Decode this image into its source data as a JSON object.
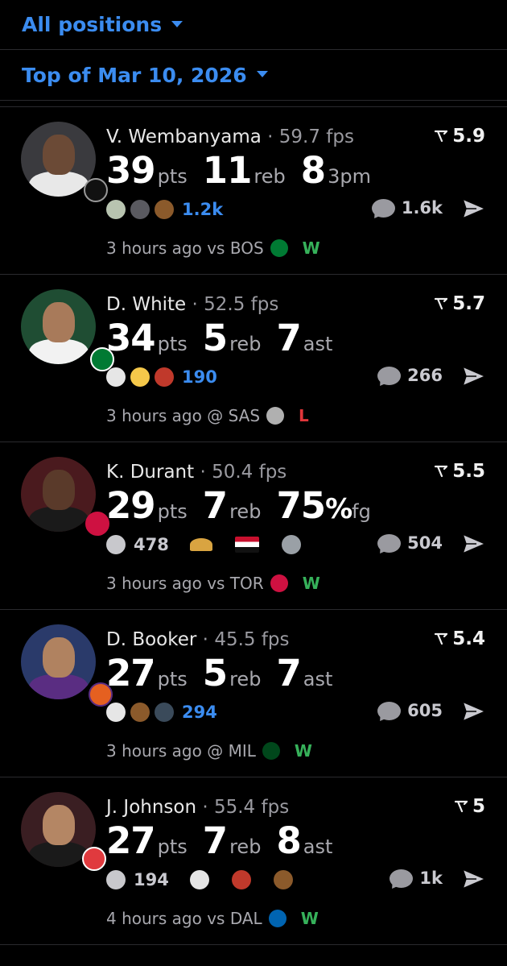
{
  "filters": {
    "position": "All positions",
    "date": "Top of Mar 10, 2026"
  },
  "colors": {
    "accent": "#3b8cf0",
    "win": "#36b15a",
    "loss": "#e0363a"
  },
  "cards": [
    {
      "name": "V. Wembanyama",
      "fps": "59.7 fps",
      "rating": "5.9",
      "stats": [
        [
          "39",
          "pts"
        ],
        [
          "11",
          "reb"
        ],
        [
          "8",
          "3pm"
        ]
      ],
      "emojis": [
        "alien-icon",
        "spy-icon",
        "poop-icon"
      ],
      "react_count": "1.2k",
      "comments": "1.6k",
      "time": "3 hours ago vs BOS",
      "opponent_logo": "celtics-logo",
      "result": "W"
    },
    {
      "name": "D. White",
      "fps": "52.5 fps",
      "rating": "5.7",
      "stats": [
        [
          "34",
          "pts"
        ],
        [
          "5",
          "reb"
        ],
        [
          "7",
          "ast"
        ]
      ],
      "emojis": [
        "goat-icon",
        "baby-icon",
        "person-icon"
      ],
      "react_count": "190",
      "comments": "266",
      "time": "3 hours ago @ SAS",
      "opponent_logo": "spurs-logo",
      "result": "L"
    },
    {
      "name": "K. Durant",
      "fps": "50.4 fps",
      "rating": "5.5",
      "stats": [
        [
          "29",
          "pts"
        ],
        [
          "7",
          "reb"
        ],
        [
          "75",
          "%",
          "fg"
        ]
      ],
      "emojis": [
        "smiley-icon",
        "taco-icon",
        "sudan-flag-icon",
        "elephant-icon"
      ],
      "react_count": "478",
      "comments": "504",
      "time": "3 hours ago vs TOR",
      "opponent_logo": "raptors-logo",
      "result": "W"
    },
    {
      "name": "D. Booker",
      "fps": "45.5 fps",
      "rating": "5.4",
      "stats": [
        [
          "27",
          "pts"
        ],
        [
          "5",
          "reb"
        ],
        [
          "7",
          "ast"
        ]
      ],
      "emojis": [
        "goat-icon",
        "poop-icon",
        "trophy-icon"
      ],
      "react_count": "294",
      "comments": "605",
      "time": "3 hours ago @ MIL",
      "opponent_logo": "bucks-logo",
      "result": "W"
    },
    {
      "name": "J. Johnson",
      "fps": "55.4 fps",
      "rating": "5",
      "stats": [
        [
          "27",
          "pts"
        ],
        [
          "7",
          "reb"
        ],
        [
          "8",
          "ast"
        ]
      ],
      "emojis": [
        "smiley-icon",
        "goat-icon",
        "person-icon",
        "poop-icon"
      ],
      "react_count": "194",
      "comments": "1k",
      "time": "4 hours ago vs DAL",
      "opponent_logo": "mavericks-logo",
      "result": "W"
    }
  ]
}
